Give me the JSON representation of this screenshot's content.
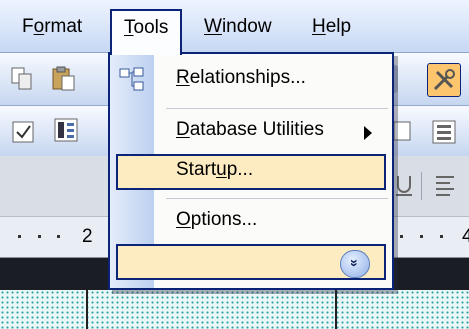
{
  "menubar": {
    "format_pre": "F",
    "format_u": "o",
    "format_post": "rmat",
    "tools_u": "T",
    "tools_post": "ools",
    "window_u": "W",
    "window_post": "indow",
    "help_u": "H",
    "help_post": "elp"
  },
  "menu": {
    "relationships_u": "R",
    "relationships_post": "elationships...",
    "dbutil_u": "D",
    "dbutil_post": "atabase Utilities",
    "startup_pre": "Start",
    "startup_u": "u",
    "startup_post": "p...",
    "options_u": "O",
    "options_post": "ptions...",
    "expand_glyph": "»"
  },
  "ruler": {
    "left_number": "2",
    "right_number": "4"
  },
  "colors": {
    "highlight": "#fdebc2",
    "menu_border": "#0b2478"
  }
}
